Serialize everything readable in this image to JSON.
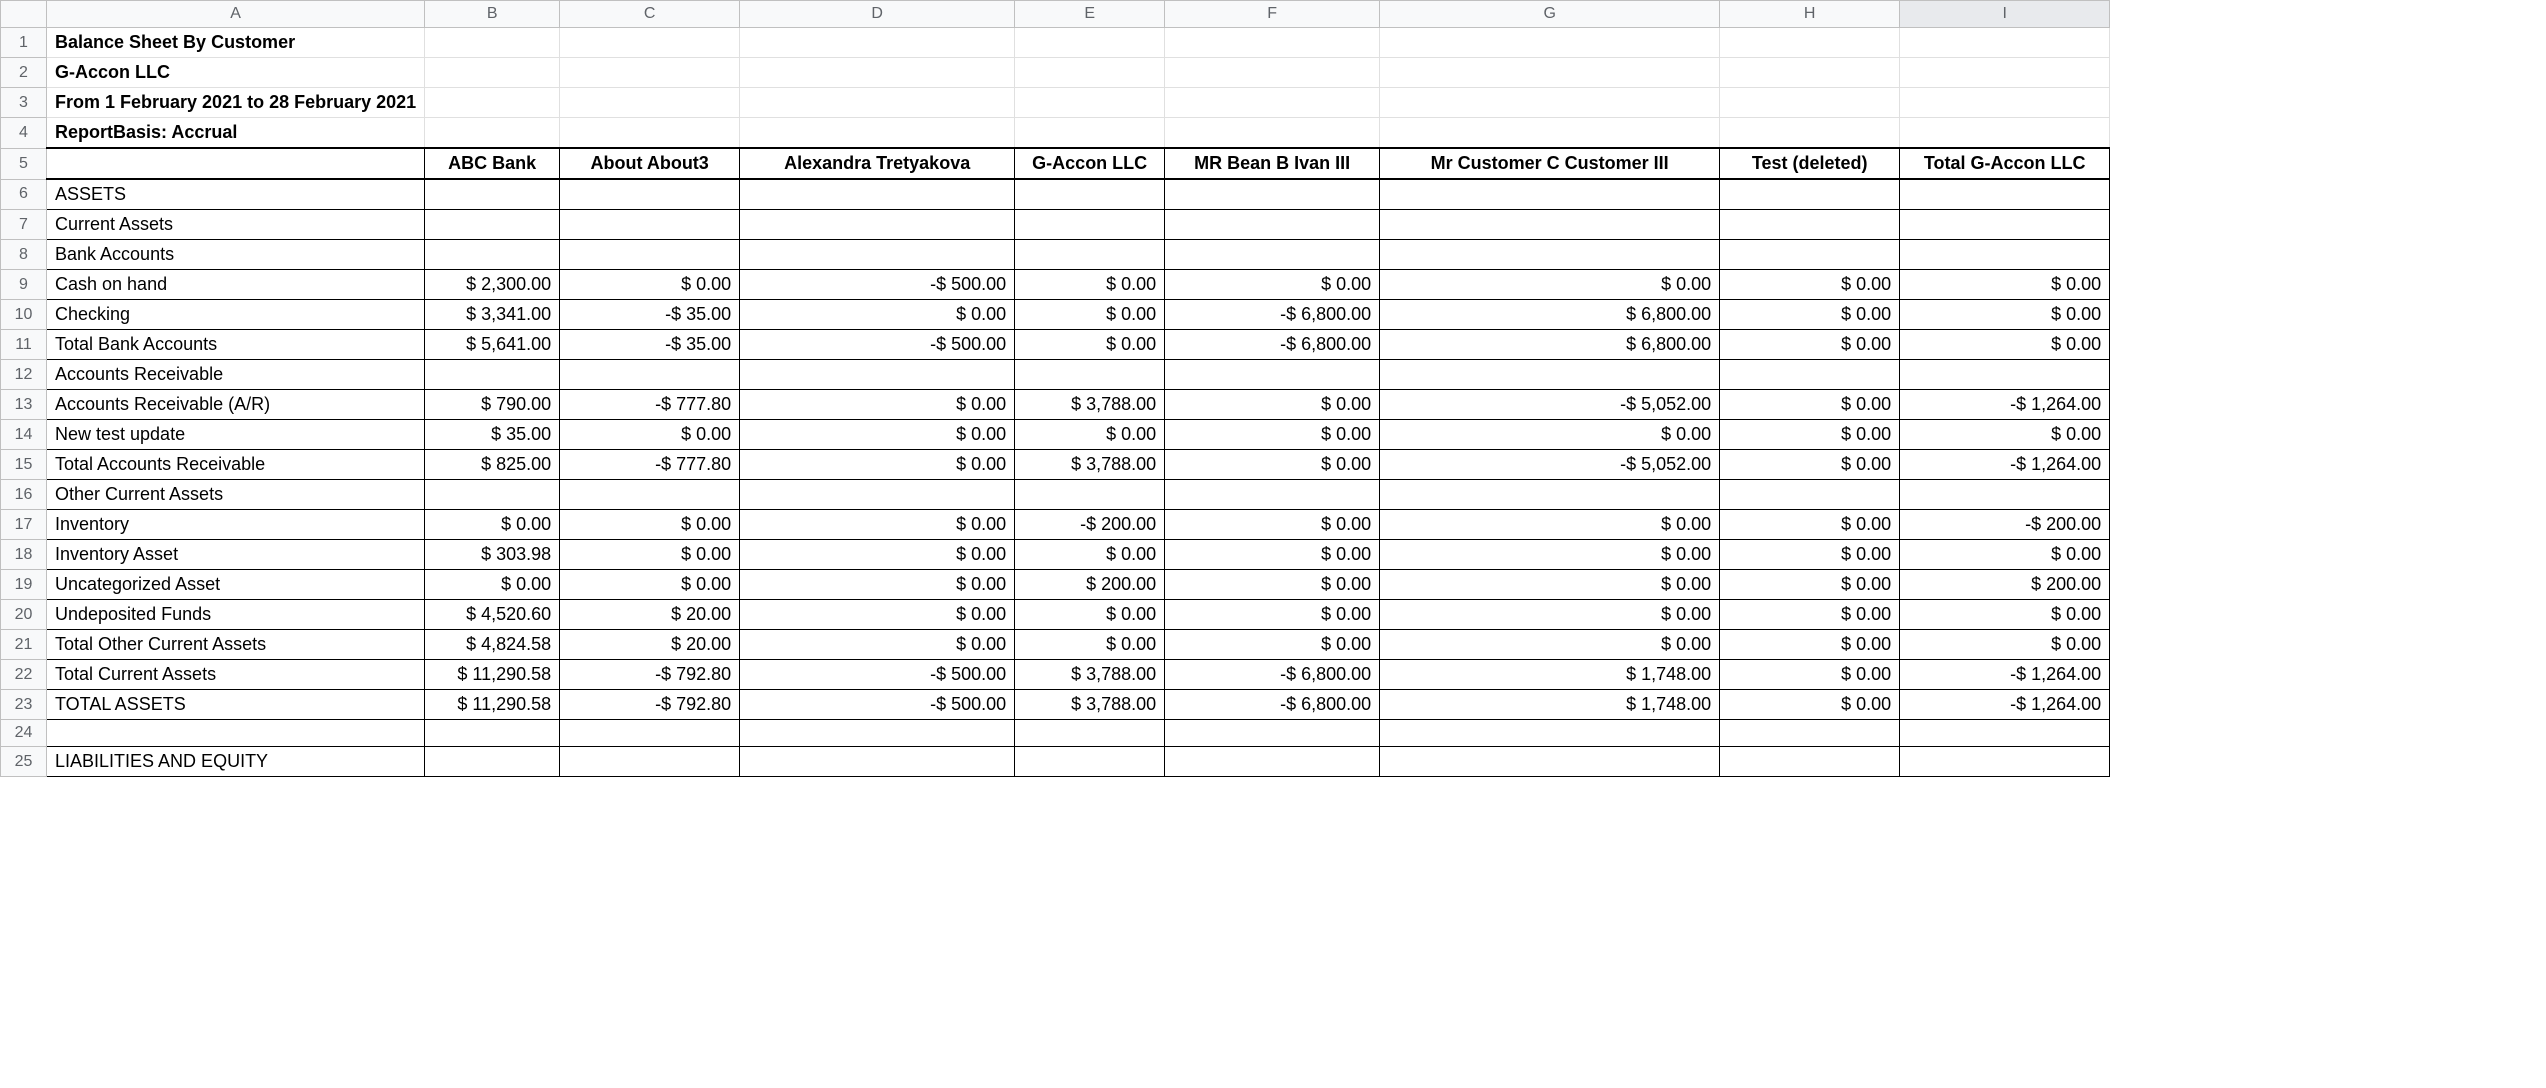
{
  "columns": [
    "A",
    "B",
    "C",
    "D",
    "E",
    "F",
    "G",
    "H",
    "I"
  ],
  "rowCount": 25,
  "selectedColumn": "I",
  "title": "Balance Sheet By Customer",
  "company": "G-Accon LLC",
  "period": "From 1 February 2021 to 28 February 2021",
  "basis": "ReportBasis: Accrual",
  "headers": {
    "A": "",
    "B": "ABC Bank",
    "C": "About About3",
    "D": "Alexandra Tretyakova",
    "E": "G-Accon LLC",
    "F": "MR Bean B Ivan III",
    "G": "Mr Customer C Customer III",
    "H": "Test (deleted)",
    "I": "Total G-Accon LLC"
  },
  "sections": {
    "assets": "ASSETS",
    "currentAssets": "Current Assets",
    "bankAccounts": "Bank Accounts",
    "accountsReceivable": "Accounts Receivable",
    "otherCurrentAssets": "Other Current Assets",
    "liabilities": "LIABILITIES AND EQUITY"
  },
  "rows": {
    "cashOnHand": {
      "label": "Cash on hand",
      "B": "$ 2,300.00",
      "C": "$ 0.00",
      "D": "-$ 500.00",
      "E": "$ 0.00",
      "F": "$ 0.00",
      "G": "$ 0.00",
      "H": "$ 0.00",
      "I": "$ 0.00"
    },
    "checking": {
      "label": "Checking",
      "B": "$ 3,341.00",
      "C": "-$ 35.00",
      "D": "$ 0.00",
      "E": "$ 0.00",
      "F": "-$ 6,800.00",
      "G": "$ 6,800.00",
      "H": "$ 0.00",
      "I": "$ 0.00"
    },
    "totalBank": {
      "label": "Total Bank Accounts",
      "B": "$ 5,641.00",
      "C": "-$ 35.00",
      "D": "-$ 500.00",
      "E": "$ 0.00",
      "F": "-$ 6,800.00",
      "G": "$ 6,800.00",
      "H": "$ 0.00",
      "I": "$ 0.00"
    },
    "ar": {
      "label": "Accounts Receivable (A/R)",
      "B": "$ 790.00",
      "C": "-$ 777.80",
      "D": "$ 0.00",
      "E": "$ 3,788.00",
      "F": "$ 0.00",
      "G": "-$ 5,052.00",
      "H": "$ 0.00",
      "I": "-$ 1,264.00"
    },
    "newTest": {
      "label": "New test update",
      "B": "$ 35.00",
      "C": "$ 0.00",
      "D": "$ 0.00",
      "E": "$ 0.00",
      "F": "$ 0.00",
      "G": "$ 0.00",
      "H": "$ 0.00",
      "I": "$ 0.00"
    },
    "totalAR": {
      "label": "Total Accounts Receivable",
      "B": "$ 825.00",
      "C": "-$ 777.80",
      "D": "$ 0.00",
      "E": "$ 3,788.00",
      "F": "$ 0.00",
      "G": "-$ 5,052.00",
      "H": "$ 0.00",
      "I": "-$ 1,264.00"
    },
    "inventory": {
      "label": "Inventory",
      "B": "$ 0.00",
      "C": "$ 0.00",
      "D": "$ 0.00",
      "E": "-$ 200.00",
      "F": "$ 0.00",
      "G": "$ 0.00",
      "H": "$ 0.00",
      "I": "-$ 200.00"
    },
    "inventoryAsset": {
      "label": "Inventory Asset",
      "B": "$ 303.98",
      "C": "$ 0.00",
      "D": "$ 0.00",
      "E": "$ 0.00",
      "F": "$ 0.00",
      "G": "$ 0.00",
      "H": "$ 0.00",
      "I": "$ 0.00"
    },
    "uncategorized": {
      "label": "Uncategorized Asset",
      "B": "$ 0.00",
      "C": "$ 0.00",
      "D": "$ 0.00",
      "E": "$ 200.00",
      "F": "$ 0.00",
      "G": "$ 0.00",
      "H": "$ 0.00",
      "I": "$ 200.00"
    },
    "undeposited": {
      "label": "Undeposited Funds",
      "B": "$ 4,520.60",
      "C": "$ 20.00",
      "D": "$ 0.00",
      "E": "$ 0.00",
      "F": "$ 0.00",
      "G": "$ 0.00",
      "H": "$ 0.00",
      "I": "$ 0.00"
    },
    "totalOther": {
      "label": "Total Other Current Assets",
      "B": "$ 4,824.58",
      "C": "$ 20.00",
      "D": "$ 0.00",
      "E": "$ 0.00",
      "F": "$ 0.00",
      "G": "$ 0.00",
      "H": "$ 0.00",
      "I": "$ 0.00"
    },
    "totalCurrent": {
      "label": "Total Current Assets",
      "B": "$ 11,290.58",
      "C": "-$ 792.80",
      "D": "-$ 500.00",
      "E": "$ 3,788.00",
      "F": "-$ 6,800.00",
      "G": "$ 1,748.00",
      "H": "$ 0.00",
      "I": "-$ 1,264.00"
    },
    "totalAssets": {
      "label": "TOTAL ASSETS",
      "B": "$ 11,290.58",
      "C": "-$ 792.80",
      "D": "-$ 500.00",
      "E": "$ 3,788.00",
      "F": "-$ 6,800.00",
      "G": "$ 1,748.00",
      "H": "$ 0.00",
      "I": "-$ 1,264.00"
    }
  }
}
